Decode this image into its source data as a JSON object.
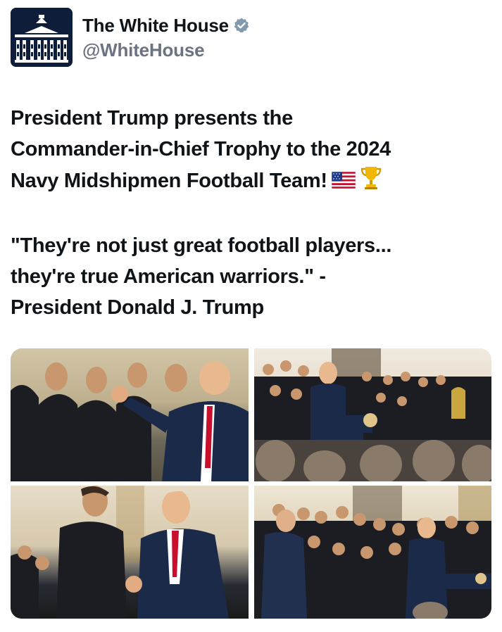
{
  "account": {
    "display_name": "The White House",
    "handle": "@WhiteHouse",
    "avatar_icon": "white-house-building-icon",
    "verified_icon": "verified-badge-icon",
    "verified_color": "#829aab"
  },
  "tweet": {
    "paragraph1": [
      "President Trump presents the",
      "Commander-in-Chief Trophy to the 2024",
      "Navy Midshipmen Football Team!"
    ],
    "paragraph1_emojis": [
      "us-flag-emoji",
      "trophy-emoji"
    ],
    "paragraph2": [
      "\"They're not just great football players...",
      "they're true American warriors.\" -",
      "President Donald J. Trump"
    ]
  },
  "media": {
    "photos": [
      {
        "description_icon": "photo-fist-pump"
      },
      {
        "description_icon": "photo-podium-speech"
      },
      {
        "description_icon": "photo-handshake"
      },
      {
        "description_icon": "photo-team-applause"
      }
    ]
  }
}
